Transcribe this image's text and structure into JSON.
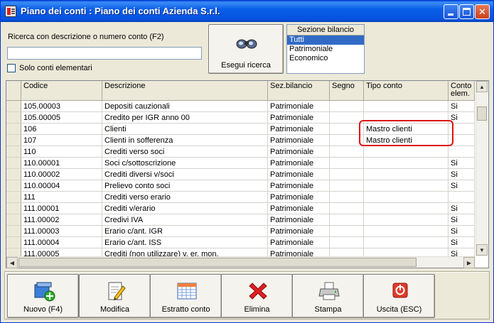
{
  "window": {
    "title": "Piano dei conti : Piano dei conti Azienda S.r.l."
  },
  "search": {
    "label": "Ricerca con descrizione o numero conto (F2)",
    "value": "",
    "only_elementary_label": "Solo conti elementari",
    "button_label": "Esegui ricerca"
  },
  "sezione": {
    "title": "Sezione bilancio",
    "options": [
      "Tutti",
      "Patrimoniale",
      "Economico"
    ],
    "selected": "Tutti"
  },
  "grid": {
    "headers": [
      "Codice",
      "Descrizione",
      "Sez.bilancio",
      "Segno",
      "Tipo conto",
      "Conto elem."
    ],
    "rows": [
      {
        "codice": "105.00003",
        "descrizione": "Depositi cauzionali",
        "sez": "Patrimoniale",
        "segno": "",
        "tipo": "",
        "elem": "Si"
      },
      {
        "codice": "105.00005",
        "descrizione": "Credito per IGR anno 00",
        "sez": "Patrimoniale",
        "segno": "",
        "tipo": "",
        "elem": "Si"
      },
      {
        "codice": "106",
        "descrizione": "Clienti",
        "sez": "Patrimoniale",
        "segno": "",
        "tipo": "Mastro clienti",
        "elem": ""
      },
      {
        "codice": "107",
        "descrizione": "Clienti in sofferenza",
        "sez": "Patrimoniale",
        "segno": "",
        "tipo": "Mastro clienti",
        "elem": ""
      },
      {
        "codice": "110",
        "descrizione": "Crediti verso soci",
        "sez": "Patrimoniale",
        "segno": "",
        "tipo": "",
        "elem": ""
      },
      {
        "codice": "110.00001",
        "descrizione": "Soci c/sottoscrizione",
        "sez": "Patrimoniale",
        "segno": "",
        "tipo": "",
        "elem": "Si"
      },
      {
        "codice": "110.00002",
        "descrizione": "Crediti diversi v/soci",
        "sez": "Patrimoniale",
        "segno": "",
        "tipo": "",
        "elem": "Si"
      },
      {
        "codice": "110.00004",
        "descrizione": "Prelievo conto soci",
        "sez": "Patrimoniale",
        "segno": "",
        "tipo": "",
        "elem": "Si"
      },
      {
        "codice": "111",
        "descrizione": "Crediti verso erario",
        "sez": "Patrimoniale",
        "segno": "",
        "tipo": "",
        "elem": ""
      },
      {
        "codice": "111.00001",
        "descrizione": "Crediti v/erario",
        "sez": "Patrimoniale",
        "segno": "",
        "tipo": "",
        "elem": "Si"
      },
      {
        "codice": "111.00002",
        "descrizione": "Credivi IVA",
        "sez": "Patrimoniale",
        "segno": "",
        "tipo": "",
        "elem": "Si"
      },
      {
        "codice": "111.00003",
        "descrizione": "Erario c/ant. IGR",
        "sez": "Patrimoniale",
        "segno": "",
        "tipo": "",
        "elem": "Si"
      },
      {
        "codice": "111.00004",
        "descrizione": "Erario c/ant. ISS",
        "sez": "Patrimoniale",
        "segno": "",
        "tipo": "",
        "elem": "Si"
      },
      {
        "codice": "111.00005",
        "descrizione": "Crediti (non utilizzare) v. er. mon.",
        "sez": "Patrimoniale",
        "segno": "",
        "tipo": "",
        "elem": "Si"
      }
    ]
  },
  "toolbar": {
    "nuovo": "Nuovo (F4)",
    "modifica": "Modifica",
    "estratto": "Estratto conto",
    "elimina": "Elimina",
    "stampa": "Stampa",
    "uscita": "Uscita (ESC)"
  },
  "icons": {
    "nuovo": "new-record-icon",
    "modifica": "edit-document-icon",
    "estratto": "calendar-grid-icon",
    "elimina": "red-x-icon",
    "stampa": "printer-icon",
    "uscita": "power-icon"
  },
  "colors": {
    "title_bar": "#0553e0",
    "selection": "#316ac5",
    "highlight_box": "#e01010"
  }
}
